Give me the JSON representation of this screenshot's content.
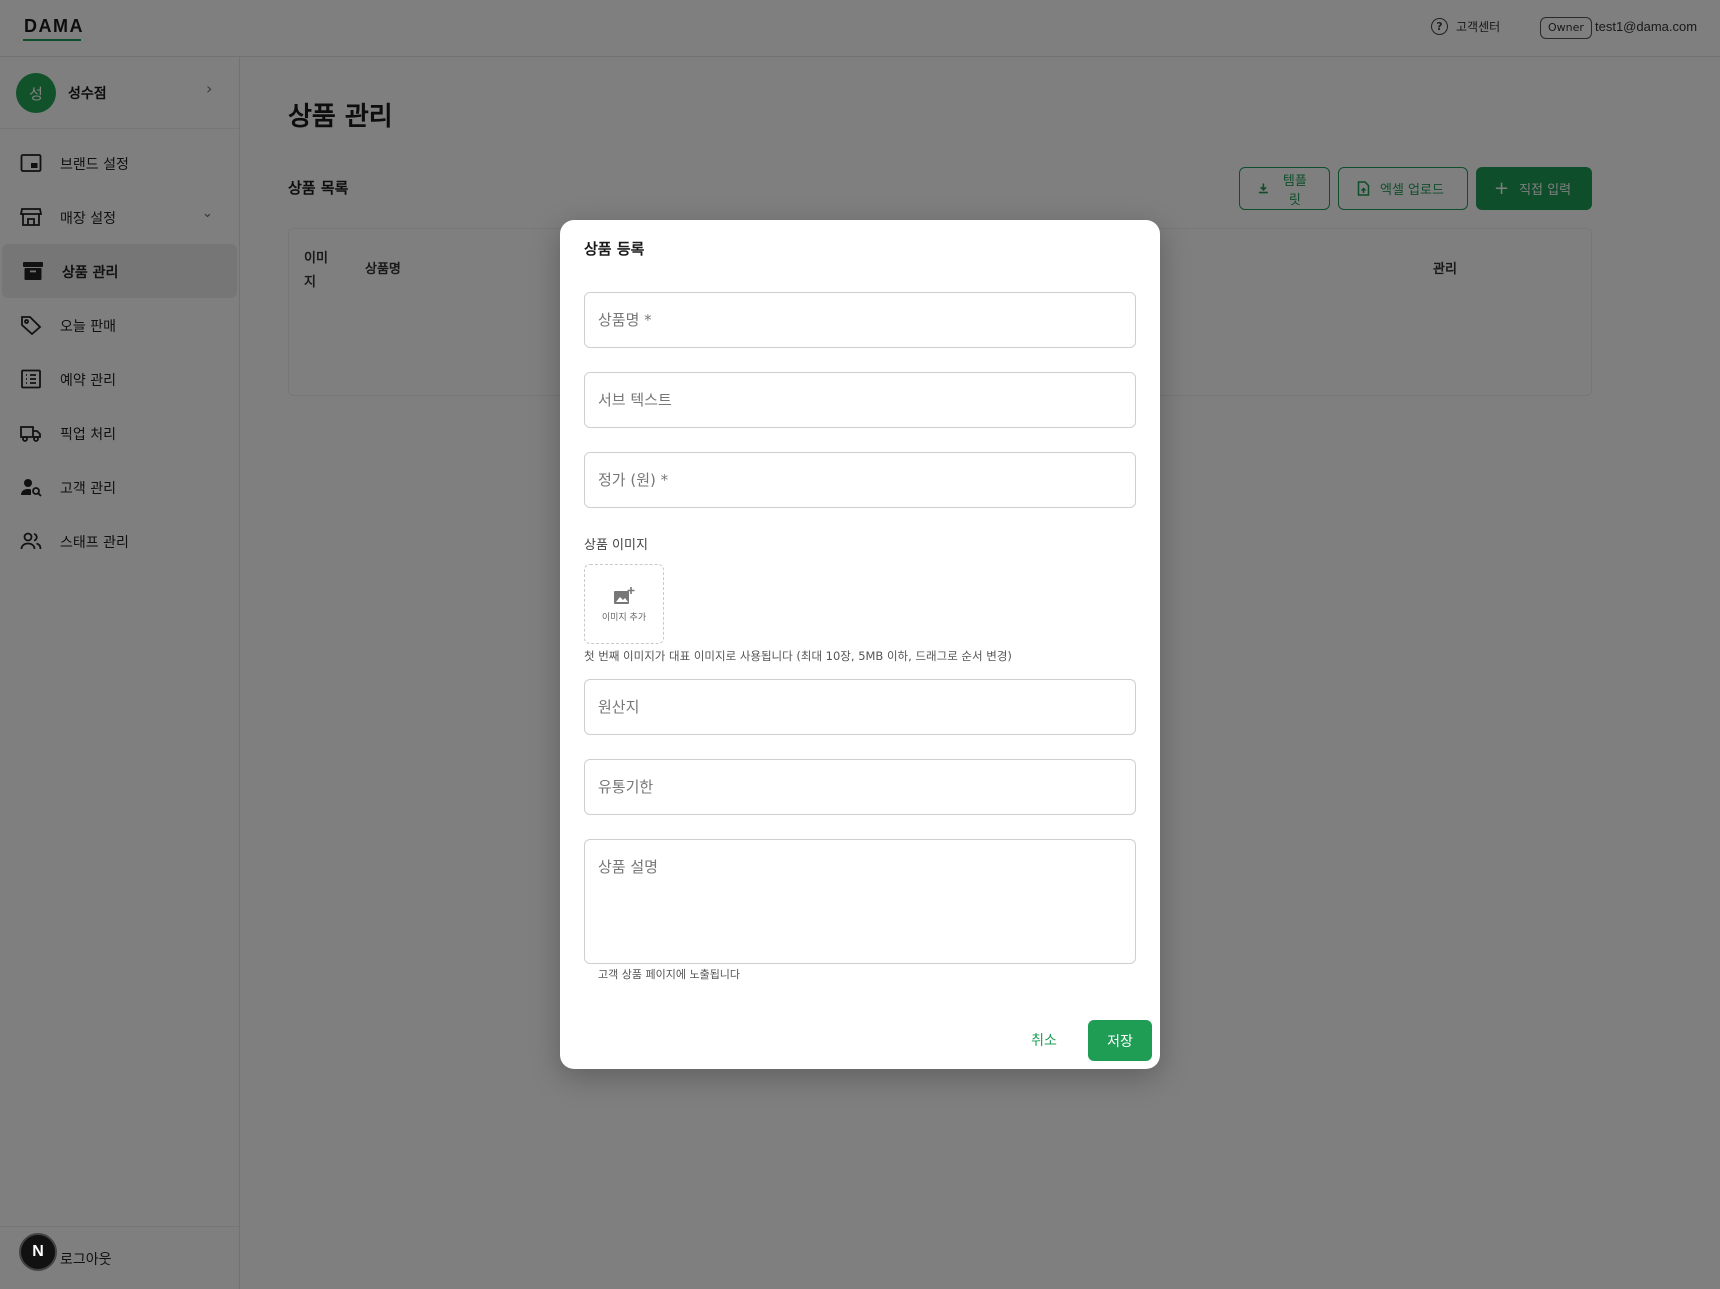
{
  "header": {
    "logo": "DAMA",
    "help_label": "고객센터",
    "role_badge": "Owner",
    "user_email": "test1@dama.com"
  },
  "sidebar": {
    "store_avatar": "성",
    "store_name": "성수점",
    "items": [
      {
        "label": "브랜드 설정",
        "icon": "brand-icon"
      },
      {
        "label": "매장 설정",
        "icon": "store-icon"
      },
      {
        "label": "상품 관리",
        "icon": "archive-icon"
      },
      {
        "label": "오늘 판매",
        "icon": "tag-icon"
      },
      {
        "label": "예약 관리",
        "icon": "list-icon"
      },
      {
        "label": "픽업 처리",
        "icon": "truck-icon"
      },
      {
        "label": "고객 관리",
        "icon": "user-search-icon"
      },
      {
        "label": "스태프 관리",
        "icon": "users-icon"
      }
    ],
    "active_item": "상품 관리",
    "logout_label": "로그아웃",
    "next_badge": "N"
  },
  "main": {
    "page_title": "상품 관리",
    "list_title": "상품 목록",
    "buttons": {
      "template": "템플릿",
      "excel_upload": "엑셀 업로드",
      "direct_input": "직접 입력"
    },
    "table_headers": [
      "이미\n지",
      "상품명",
      "관리"
    ]
  },
  "modal": {
    "title": "상품 등록",
    "fields": {
      "name_placeholder": "상품명 *",
      "subtext_placeholder": "서브 텍스트",
      "price_placeholder": "정가 (원) *",
      "origin_placeholder": "원산지",
      "expiry_placeholder": "유통기한",
      "description_placeholder": "상품 설명"
    },
    "image_label": "상품 이미지",
    "image_add_label": "이미지 추가",
    "image_help": "첫 번째 이미지가 대표 이미지로 사용됩니다 (최대 10장, 5MB 이하, 드래그로 순서 변경)",
    "description_help": "고객 상품 페이지에 노출됩니다",
    "cancel_label": "취소",
    "save_label": "저장"
  },
  "colors": {
    "accent": "#1f9d55",
    "overlay": "rgba(0,0,0,0.5)"
  }
}
